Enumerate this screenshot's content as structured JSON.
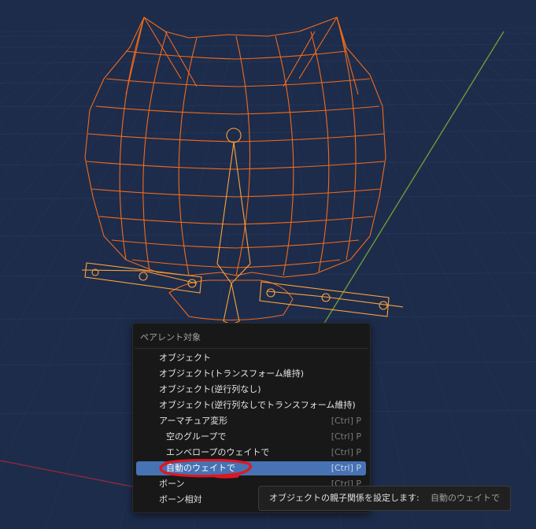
{
  "menu": {
    "title": "ペアレント対象",
    "items": [
      {
        "label": "オブジェクト",
        "shortcut": ""
      },
      {
        "label": "オブジェクト(トランスフォーム維持)",
        "shortcut": ""
      },
      {
        "label": "オブジェクト(逆行列なし)",
        "shortcut": ""
      },
      {
        "label": "オブジェクト(逆行列なしでトランスフォーム維持)",
        "shortcut": ""
      },
      {
        "label": "アーマチュア変形",
        "shortcut": "[Ctrl] P"
      },
      {
        "label": "空のグループで",
        "shortcut": "[Ctrl] P"
      },
      {
        "label": "エンベロープのウェイトで",
        "shortcut": "[Ctrl] P"
      },
      {
        "label": "自動のウェイトで",
        "shortcut": "[Ctrl] P"
      },
      {
        "label": "ボーン",
        "shortcut": "[Ctrl] P"
      },
      {
        "label": "ボーン相対",
        "shortcut": ""
      }
    ],
    "active_item": "自動のウェイトで"
  },
  "tooltip": {
    "text": "オブジェクトの親子関係を設定します:",
    "value": "自動のウェイトで"
  },
  "colors": {
    "viewport_bg": "#1d2c4b",
    "wireframe": "#f26a1b",
    "bone": "#ffa23a",
    "menu_bg": "#181818",
    "highlight": "#4772b3",
    "annotation": "#e0161f",
    "y_axis": "#6c9a3a",
    "x_axis": "#8a2b3c"
  }
}
